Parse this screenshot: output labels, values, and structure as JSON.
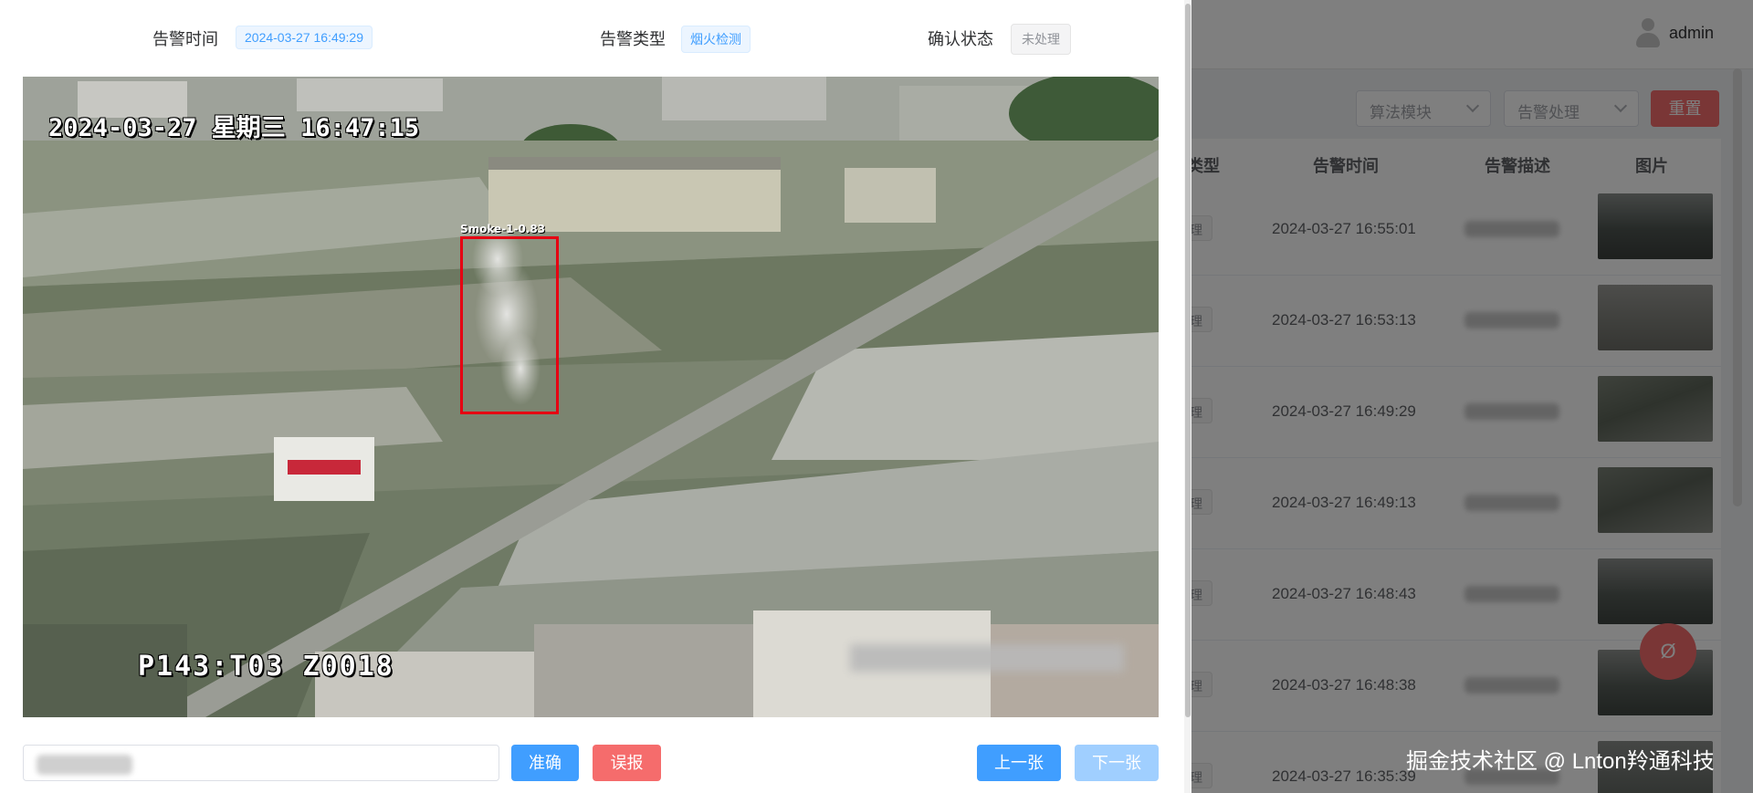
{
  "background": {
    "user": {
      "name": "admin"
    },
    "filters": {
      "algorithm_select": {
        "value": "算法模块"
      },
      "handling_select": {
        "value": "告警处理"
      },
      "reset_label": "重置"
    },
    "table": {
      "headers": {
        "type_partial": "类型",
        "time": "告警时间",
        "description": "告警描述",
        "image": "图片"
      },
      "rows": [
        {
          "status": "理",
          "time": "2024-03-27 16:55:01"
        },
        {
          "status": "理",
          "time": "2024-03-27 16:53:13"
        },
        {
          "status": "理",
          "time": "2024-03-27 16:49:29"
        },
        {
          "status": "理",
          "time": "2024-03-27 16:49:13"
        },
        {
          "status": "理",
          "time": "2024-03-27 16:48:43"
        },
        {
          "status": "理",
          "time": "2024-03-27 16:48:38"
        },
        {
          "status": "理",
          "time": "2024-03-27 16:35:39"
        }
      ]
    },
    "fab_icon": "Ø",
    "watermark": "掘金技术社区 @ Lnton羚通科技"
  },
  "drawer": {
    "alarm_time": {
      "label": "告警时间",
      "value": "2024-03-27 16:49:29"
    },
    "alarm_type": {
      "label": "告警类型",
      "value": "烟火检测"
    },
    "confirm_status": {
      "label": "确认状态",
      "value": "未处理"
    },
    "camera": {
      "osd_datetime": "2024-03-27 星期三 16:47:15",
      "osd_camera_code": "P143:T03 Z0018",
      "detection": {
        "label": "Smoke-1-0.83",
        "class": "Smoke",
        "confidence": 0.83
      }
    },
    "actions": {
      "accurate_label": "准确",
      "false_alarm_label": "误报",
      "prev_label": "上一张",
      "next_label": "下一张"
    },
    "colors": {
      "primary": "#409eff",
      "danger": "#f56c6c",
      "primary_light": "#a0cfff",
      "detection_box": "#e60012"
    }
  }
}
